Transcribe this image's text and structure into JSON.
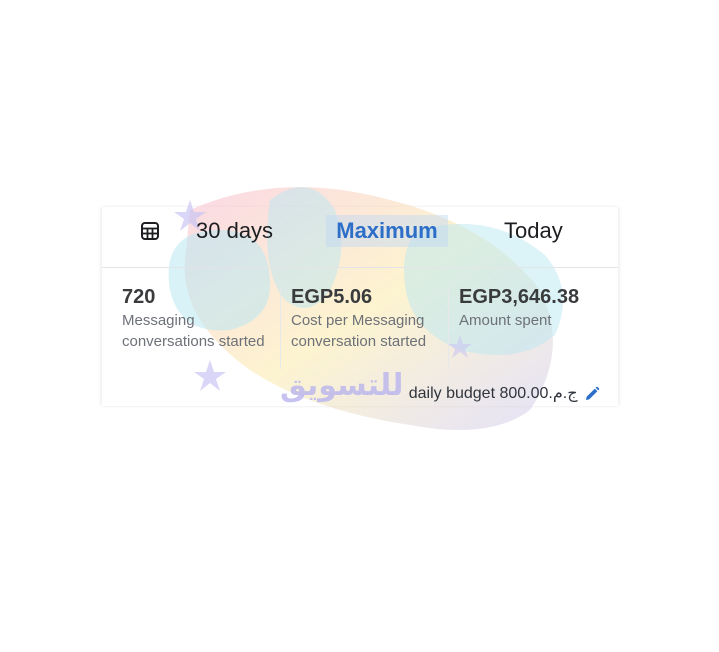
{
  "tabs": {
    "icon": "table-icon",
    "items": [
      {
        "label": "30 days",
        "active": false
      },
      {
        "label": "Maximum",
        "active": true
      },
      {
        "label": "Today",
        "active": false
      }
    ]
  },
  "metrics": [
    {
      "value": "720",
      "label": "Messaging conversations started"
    },
    {
      "value": "EGP5.06",
      "label": "Cost per Messaging conversation started"
    },
    {
      "value": "EGP3,646.38",
      "label": "Amount spent"
    }
  ],
  "budget": {
    "text": "daily budget 800.00.ج.م",
    "icon": "pencil-icon"
  },
  "watermark": {
    "text": "للتسويق",
    "colors": [
      "#f6b8d0",
      "#fbe8a0",
      "#b9e8f2",
      "#c9c4f3"
    ]
  },
  "colors": {
    "accent": "#2d6ec9",
    "text": "#1c1e21",
    "muted": "#6d7178"
  }
}
